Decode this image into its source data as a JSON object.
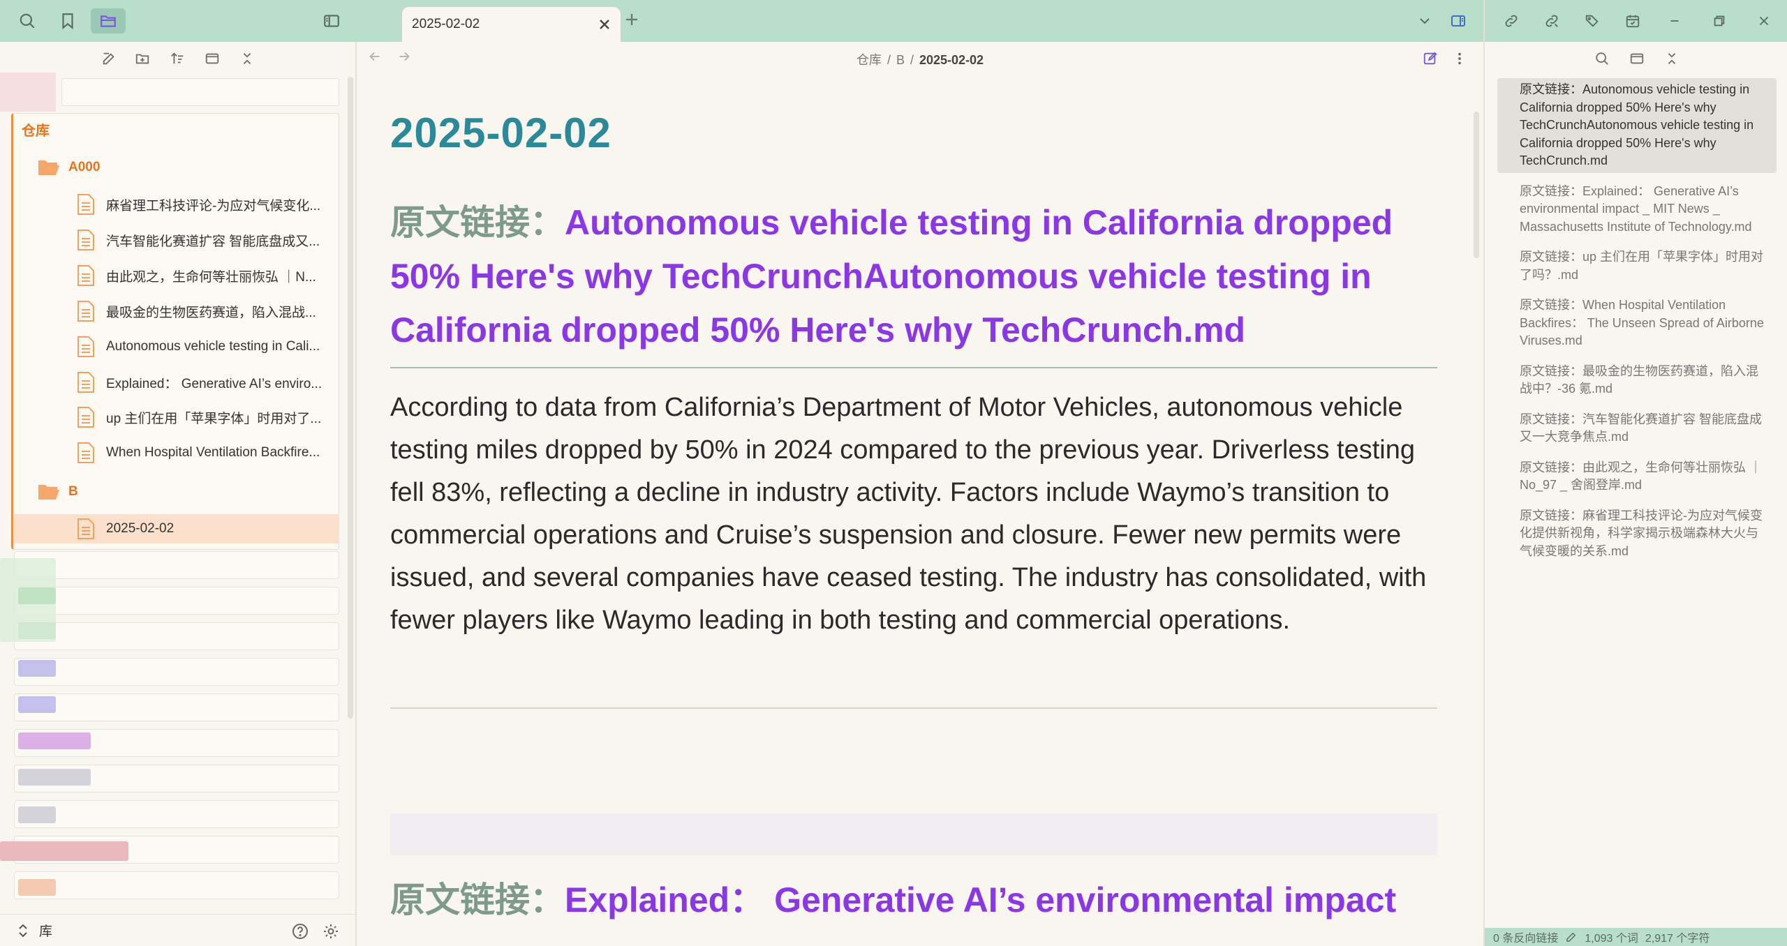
{
  "left_sidebar": {
    "vault_name": "仓库",
    "folders": [
      {
        "name": "A000"
      },
      {
        "name": "B"
      }
    ],
    "files_a000": [
      "麻省理工科技评论-为应对气候变化...",
      "汽车智能化赛道扩容 智能底盘成又...",
      "由此观之，生命何等壮丽恢弘 ｜N...",
      "最吸金的生物医药赛道，陷入混战...",
      "Autonomous vehicle testing in Cali...",
      "Explained： Generative AI’s enviro...",
      "up 主们在用「苹果字体」时用对了...",
      "When Hospital Ventilation Backfire..."
    ],
    "files_b": [
      "2025-02-02"
    ],
    "footer_label": "库"
  },
  "tabs": [
    {
      "label": "2025-02-02"
    }
  ],
  "editor": {
    "breadcrumb": [
      "仓库",
      "B",
      "2025-02-02"
    ],
    "title": "2025-02-02",
    "heading1_prefix": "原文链接：",
    "heading1_text": "Autonomous vehicle testing in California dropped 50%  Here's why TechCrunchAutonomous vehicle testing in California dropped 50%  Here's why TechCrunch.md",
    "body": "According to data from California’s Department of Motor Vehicles, autonomous vehicle testing miles dropped by 50% in 2024 compared to the previous year. Driverless testing fell 83%, reflecting a decline in industry activity. Factors include Waymo’s transition to commercial operations and Cruise’s suspension and closure. Fewer new permits were issued, and several companies have ceased testing. The industry has consolidated, with fewer players like Waymo leading in both testing and commercial operations.",
    "heading2_prefix": "原文链接：",
    "heading2_text": "Explained：  Generative AI’s environmental impact"
  },
  "right_sidebar": {
    "backlinks": [
      "原文链接：Autonomous vehicle testing in California dropped 50%  Here's why TechCrunchAutonomous vehicle testing in California dropped 50%  Here's why TechCrunch.md",
      "原文链接：Explained： Generative AI’s environmental impact _ MIT News _ Massachusetts Institute of Technology.md",
      "原文链接：up 主们在用「苹果字体」时用对了吗？.md",
      "原文链接：When Hospital Ventilation Backfires：  The Unseen Spread of Airborne Viruses.md",
      "原文链接：最吸金的生物医药赛道，陷入混战中？-36 氪.md",
      "原文链接：汽车智能化赛道扩容 智能底盘成又一大竞争焦点.md",
      "原文链接：由此观之，生命何等壮丽恢弘 ｜No_97 _ 舍阁登岸.md",
      "原文链接：麻省理工科技评论-为应对气候变化提供新视角，科学家揭示极端森林大火与气候变暖的关系.md"
    ],
    "status": {
      "backlinks": "0 条反向链接",
      "words": "1,093 个词",
      "chars": "2,917 个字符"
    }
  },
  "colors": {
    "ribbon": "#b9dfcb",
    "accent_purple": "#8a37e6",
    "title_teal": "#2b8a97",
    "folder_orange": "#e8741d"
  }
}
